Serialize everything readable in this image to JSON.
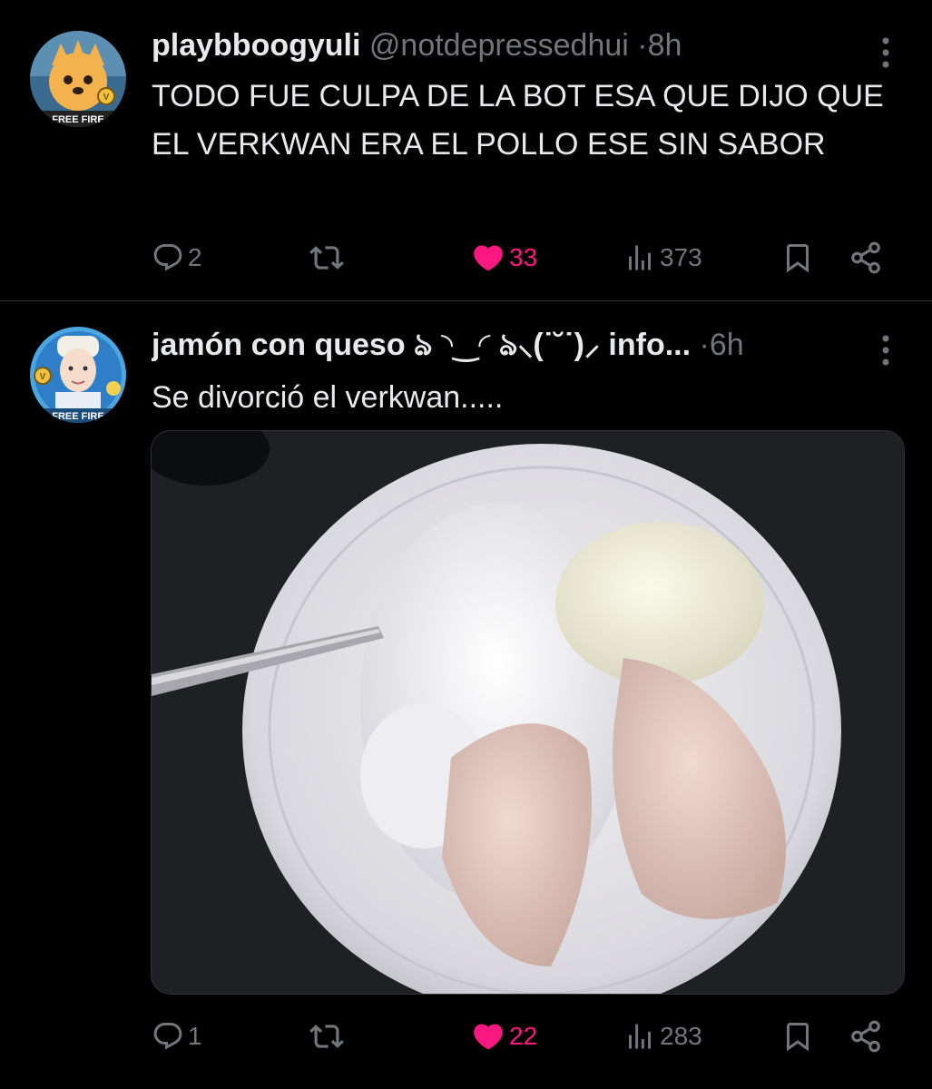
{
  "tweets": [
    {
      "display_name": "playbboogyuli",
      "handle": "@notdepressedhui",
      "separator": "·",
      "time": "8h",
      "text": "TODO FUE CULPA DE LA BOT ESA QUE DIJO QUE EL VERKWAN ERA EL POLLO ESE SIN SABOR",
      "avatar_text": "FREE FIRE",
      "avatar_badge": "V",
      "replies": "2",
      "likes": "33",
      "views": "373",
      "liked": true
    },
    {
      "display_name": "jamón con queso ঌ ◝‿◜ ঌ⸜(˙˘˙)⸝ info...",
      "separator": "·",
      "time": "6h",
      "text": "Se divorció el verkwan.....",
      "avatar_text": "FREE FIRE",
      "avatar_badge": "V",
      "replies": "1",
      "likes": "22",
      "views": "283",
      "liked": true
    }
  ],
  "colors": {
    "background": "#000000",
    "text": "#e7e9ea",
    "muted": "#71767b",
    "like": "#f91880",
    "divider": "#2f3336"
  },
  "icons": [
    "reply-icon",
    "retweet-icon",
    "heart-icon",
    "views-icon",
    "bookmark-icon",
    "share-icon",
    "more-icon"
  ]
}
